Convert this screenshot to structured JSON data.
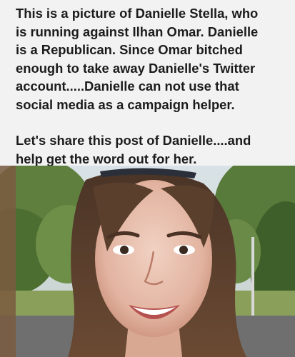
{
  "post": {
    "paragraph_1": "This is a picture of Danielle Stella, who\nis running against Ilhan Omar.  Danielle\nis a Republican.  Since Omar bitched\nenough to take away Danielle's Twitter\naccount.....Danielle can not use that\nsocial media as a campaign helper.",
    "paragraph_2": "Let's share this post of Danielle....and\nhelp get the word out for her."
  },
  "photo": {
    "subject": "smiling-woman-portrait"
  }
}
